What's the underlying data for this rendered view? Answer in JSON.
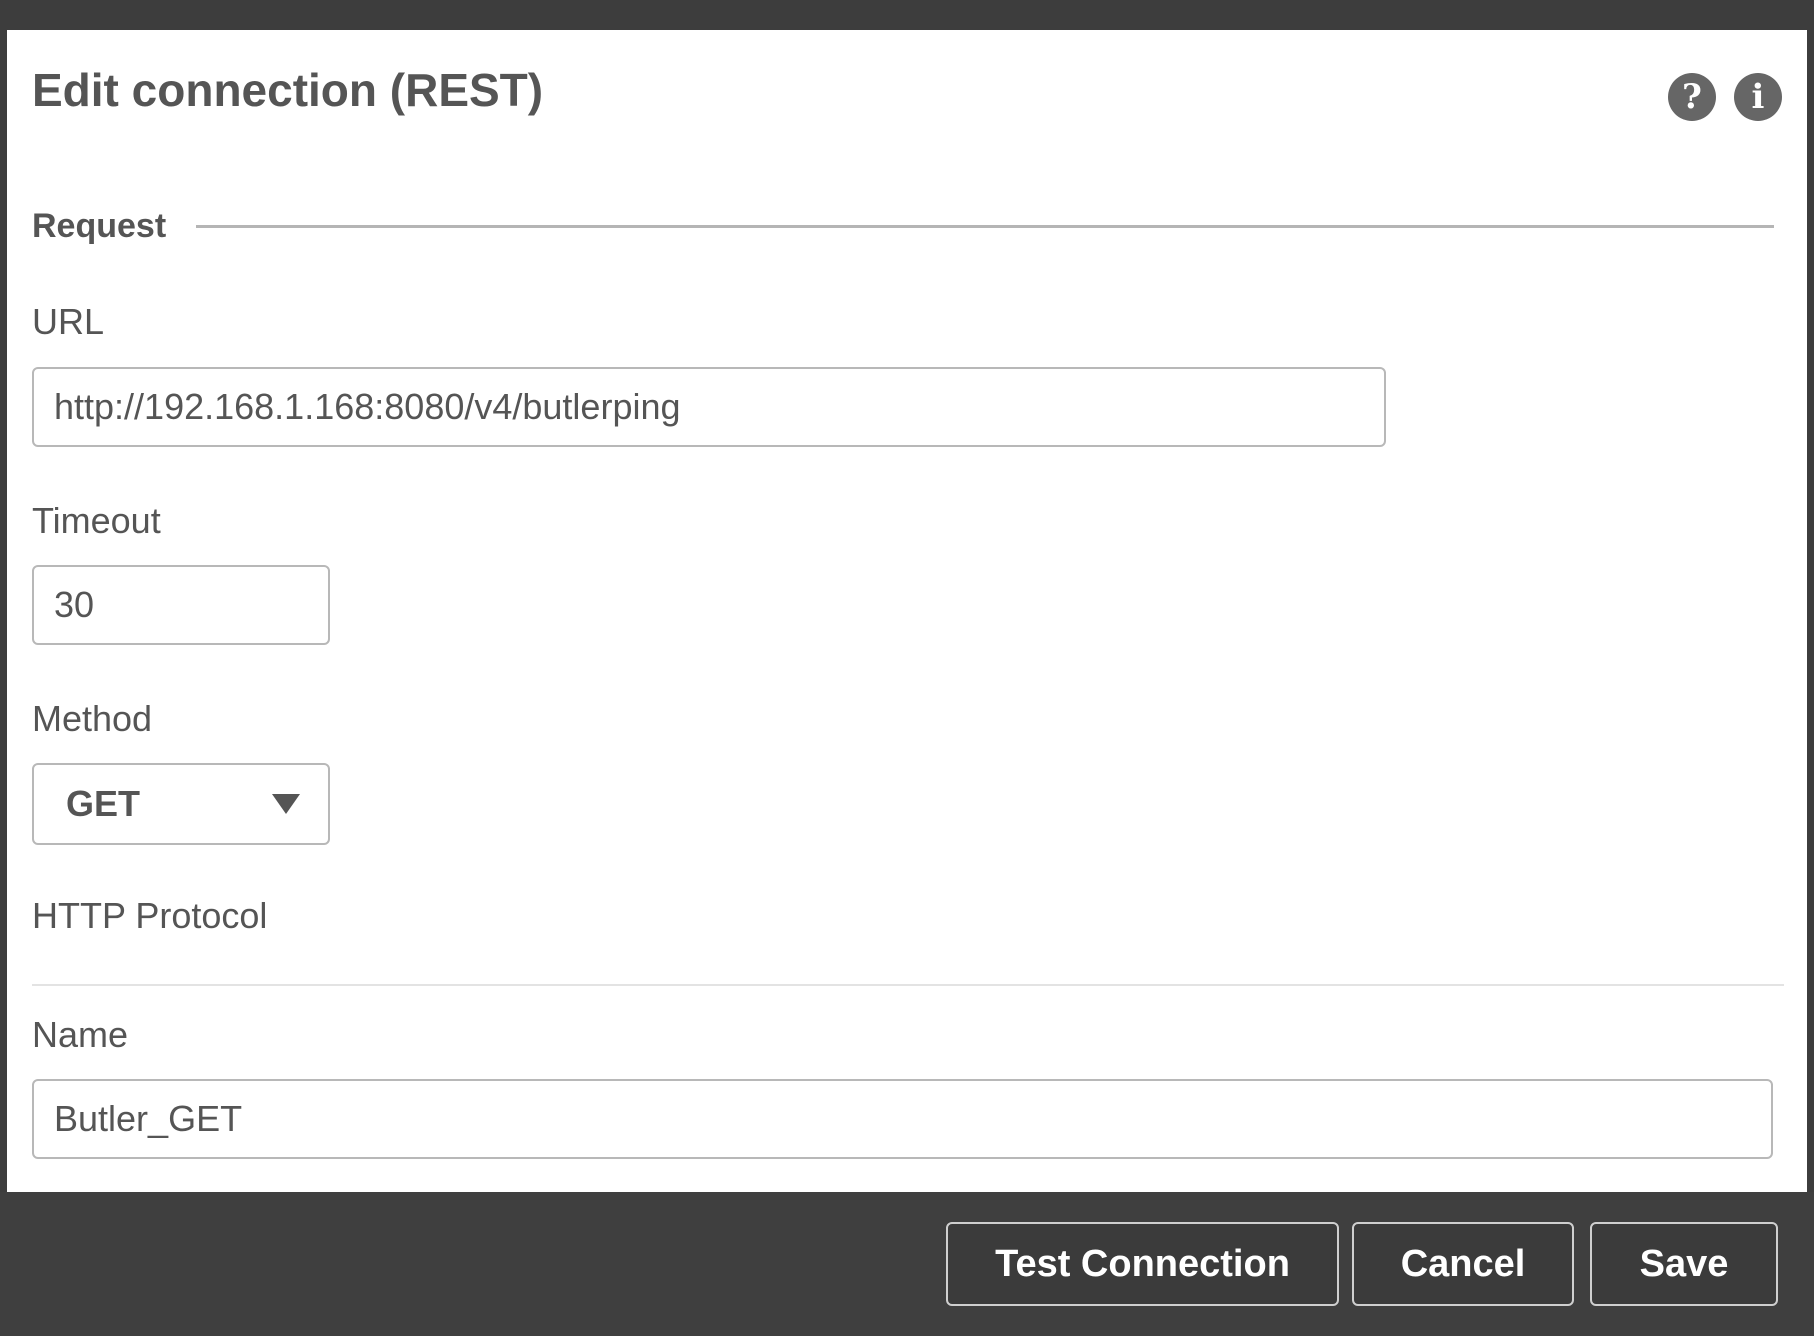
{
  "dialog": {
    "title": "Edit connection (REST)",
    "help_icon": "question-circle-icon",
    "info_icon": "info-circle-icon",
    "help_glyph": "?",
    "info_glyph": "i"
  },
  "section": {
    "title": "Request"
  },
  "fields": {
    "url": {
      "label": "URL",
      "value": "http://192.168.1.168:8080/v4/butlerping"
    },
    "timeout": {
      "label": "Timeout",
      "value": "30"
    },
    "method": {
      "label": "Method",
      "selected": "GET"
    },
    "http_protocol": {
      "label": "HTTP Protocol"
    },
    "name": {
      "label": "Name",
      "value": "Butler_GET"
    }
  },
  "footer": {
    "test_connection_label": "Test Connection",
    "cancel_label": "Cancel",
    "save_label": "Save"
  },
  "colors": {
    "frame": "#3d3d3d",
    "text": "#555555",
    "icon_bg": "#666666",
    "border": "#b8b8b8"
  }
}
